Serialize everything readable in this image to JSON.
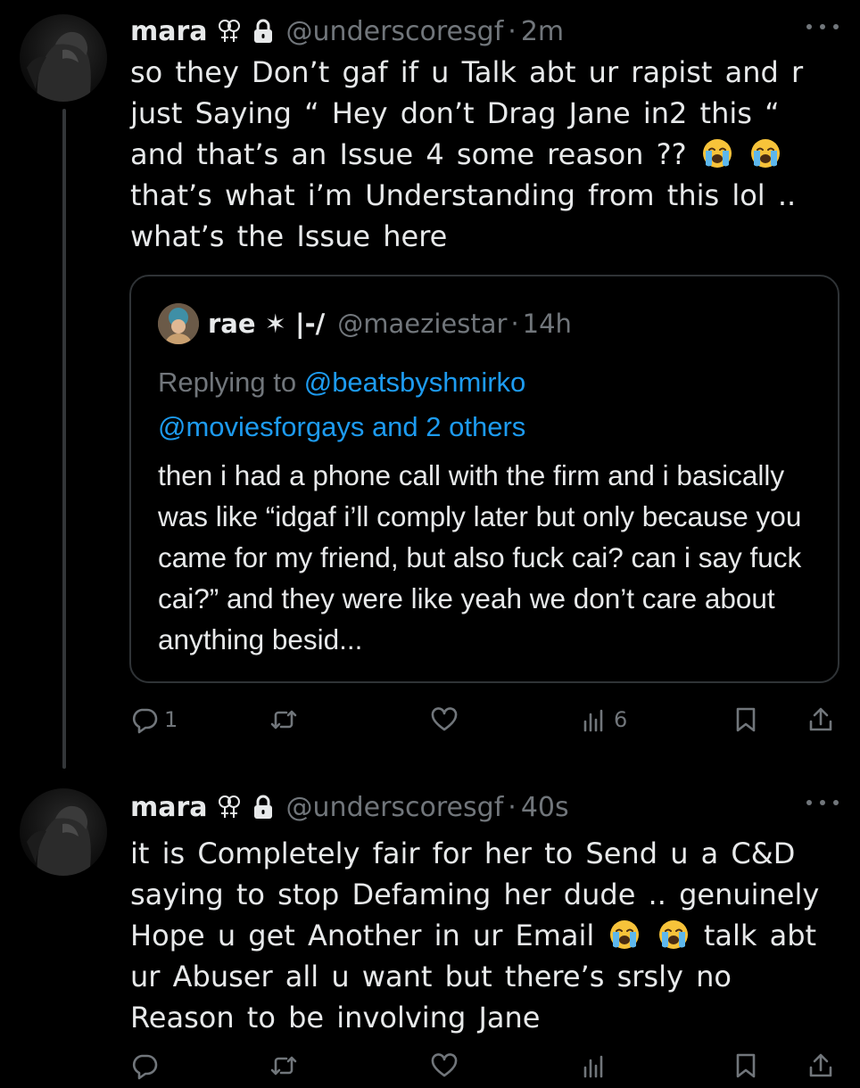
{
  "colors": {
    "background": "#000000",
    "text": "#e7e9ea",
    "secondary": "#71767b",
    "link": "#1d9bf0",
    "border": "#2f3336"
  },
  "tweets": [
    {
      "display_name": "mara",
      "handle": "@underscoresgf",
      "separator": "·",
      "time": "2m",
      "text_parts": [
        "so they Don’t gaf if u Talk abt ur rapist and r just Saying “ Hey don’t Drag Jane in2 this “ and that’s an Issue 4 some reason ?? ",
        " that’s what i’m Understanding from this lol .. what’s the Issue here"
      ],
      "quote": {
        "display_name": "rae ✶ |-/",
        "handle": "@maeziestar",
        "separator": "·",
        "time": "14h",
        "replying_prefix": "Replying to ",
        "replying_mention_1": "@beatsbyshmirko",
        "replying_mention_2": "@moviesforgays",
        "replying_and": " and ",
        "replying_others": "2 others",
        "text": "then i had a phone call with the firm and i basically was like “idgaf i’ll comply later but only because you came for my friend, but also fuck cai? can i say fuck cai?” and they were like yeah we don’t care about anything besid..."
      },
      "actions": {
        "reply_count": "1",
        "retweet_count": "",
        "like_count": "",
        "views_count": "6"
      }
    },
    {
      "display_name": "mara",
      "handle": "@underscoresgf",
      "separator": "·",
      "time": "40s",
      "text_parts": [
        "it is Completely fair for her to Send u a C&D saying to stop Defaming her dude .. genuinely Hope u get Another in ur Email ",
        " talk abt ur Abuser all u want but there’s srsly no Reason to be involving Jane"
      ]
    }
  ],
  "icons": {
    "verified_symbol": "venus-double-icon",
    "protected": "lock-icon",
    "emoji": "loudly-crying-face-icon",
    "reply": "reply-icon",
    "retweet": "retweet-icon",
    "like": "heart-icon",
    "views": "views-icon",
    "bookmark": "bookmark-icon",
    "share": "share-icon",
    "more": "more-icon"
  }
}
